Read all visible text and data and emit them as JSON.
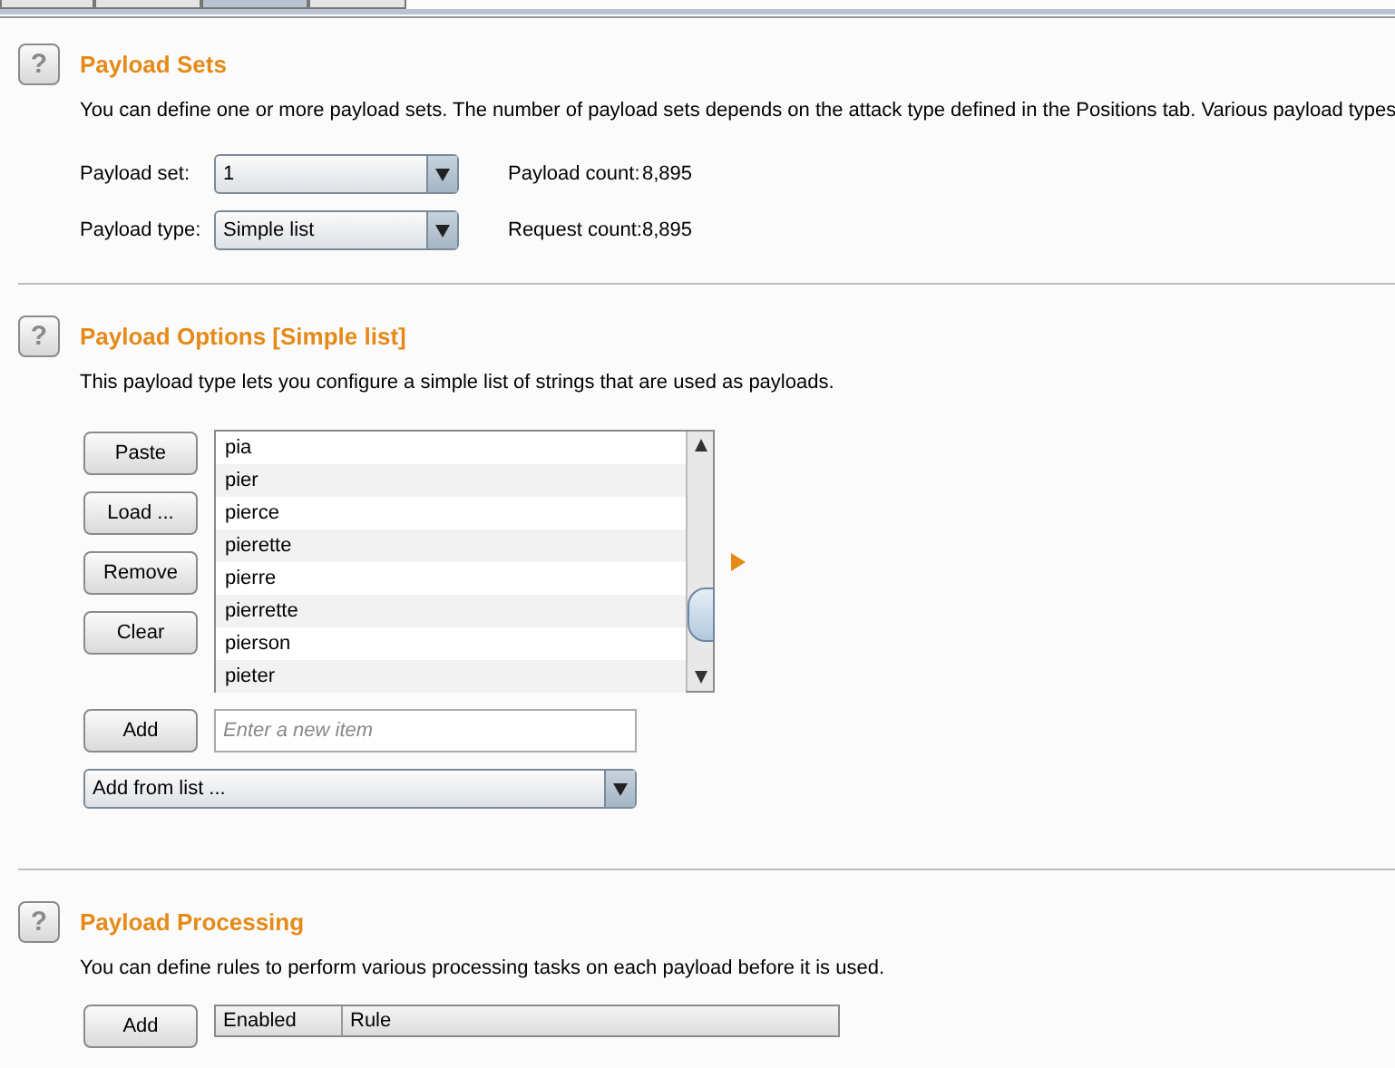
{
  "tabs": [
    {
      "selected": false
    },
    {
      "selected": false
    },
    {
      "selected": true
    },
    {
      "selected": false
    }
  ],
  "payload_sets": {
    "help": "?",
    "title": "Payload Sets",
    "description": "You can define one or more payload sets. The number of payload sets depends on the attack type defined in the Positions tab. Various payload types",
    "payload_set": {
      "label": "Payload set:",
      "value": "1"
    },
    "payload_type": {
      "label": "Payload type:",
      "value": "Simple list"
    },
    "payload_count": {
      "label": "Payload count:",
      "value": "8,895"
    },
    "request_count": {
      "label": "Request count:",
      "value": "8,895"
    }
  },
  "payload_options": {
    "help": "?",
    "title": "Payload Options [Simple list]",
    "description": "This payload type lets you configure a simple list of strings that are used as payloads.",
    "buttons": [
      "Paste",
      "Load ...",
      "Remove",
      "Clear"
    ],
    "items": [
      "pia",
      "pier",
      "pierce",
      "pierette",
      "pierre",
      "pierrette",
      "pierson",
      "pieter"
    ],
    "add_button": "Add",
    "new_item": {
      "placeholder": "Enter a new item"
    },
    "add_from_list": "Add from list ..."
  },
  "payload_processing": {
    "help": "?",
    "title": "Payload Processing",
    "description": "You can define rules to perform various processing tasks on each payload before it is used.",
    "add_button": "Add",
    "table": {
      "columns": [
        "Enabled",
        "Rule"
      ]
    }
  }
}
